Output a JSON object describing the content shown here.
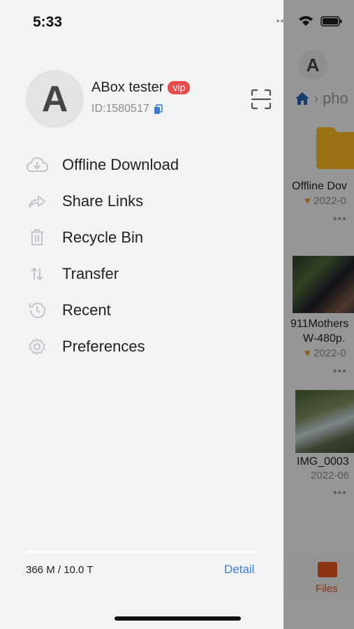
{
  "status": {
    "time": "5:33"
  },
  "background": {
    "avatar_letter": "A",
    "breadcrumb": "pho",
    "items": [
      {
        "name": "Offline Dov",
        "date": "2022-0"
      },
      {
        "name": "911Mothers",
        "name2": "W-480p.",
        "date": "2022-0"
      },
      {
        "name": "IMG_0003",
        "date": "2022-06"
      }
    ],
    "tab_label": "Files"
  },
  "profile": {
    "avatar_letter": "A",
    "name": "ABox tester",
    "badge": "vip",
    "id": "ID:1580517"
  },
  "menu": [
    {
      "label": "Offline Download",
      "icon": "cloud-download-icon"
    },
    {
      "label": "Share Links",
      "icon": "share-arrow-icon"
    },
    {
      "label": "Recycle Bin",
      "icon": "trash-icon"
    },
    {
      "label": "Transfer",
      "icon": "transfer-arrows-icon"
    },
    {
      "label": "Recent",
      "icon": "history-clock-icon"
    },
    {
      "label": "Preferences",
      "icon": "gear-icon"
    }
  ],
  "footer": {
    "storage": "366 M / 10.0 T",
    "detail_label": "Detail"
  },
  "colors": {
    "vip_badge": "#e84b4b",
    "link": "#3d7bd3",
    "accent": "#e0531d",
    "folder": "#f5b820"
  }
}
